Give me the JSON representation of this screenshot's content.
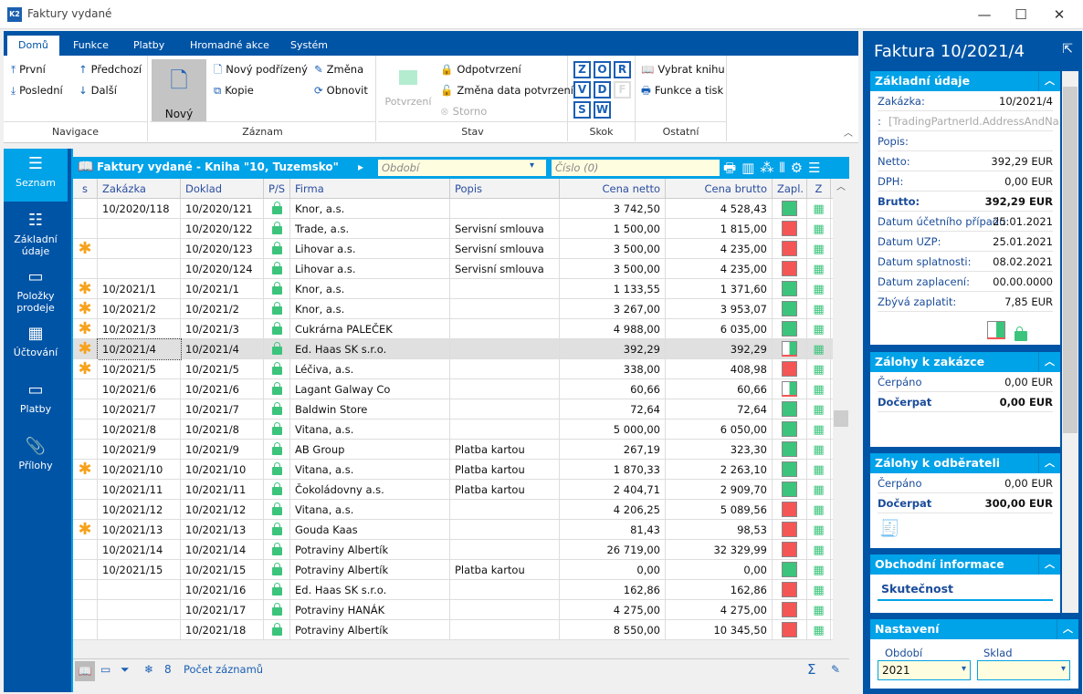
{
  "window": {
    "title": "Faktury vydané",
    "minimize": "—",
    "maximize": "☐",
    "close": "✕"
  },
  "ribbon": {
    "tabs": [
      "Domů",
      "Funkce",
      "Platby",
      "Hromadné akce",
      "Systém"
    ],
    "navigace": {
      "label": "Navigace",
      "prvni": "První",
      "posledni": "Poslední",
      "predchozi": "Předchozí",
      "dalsi": "Další"
    },
    "zaznam": {
      "label": "Záznam",
      "novy": "Nový",
      "novy_podrizeny": "Nový podřízený",
      "kopie": "Kopie",
      "zmena": "Změna",
      "obnovit": "Obnovit"
    },
    "stav": {
      "label": "Stav",
      "potvrzeni": "Potvrzení",
      "odpotvrzeni": "Odpotvrzení",
      "zmena_data": "Změna data potvrzení",
      "storno": "Storno"
    },
    "skok": {
      "label": "Skok",
      "keys": [
        "Z",
        "O",
        "R",
        "V",
        "D",
        "F",
        "S",
        "W"
      ]
    },
    "ostatni": {
      "label": "Ostatní",
      "vybrat_knihu": "Vybrat knihu",
      "funkce_tisk": "Funkce a tisk"
    }
  },
  "sidebar": {
    "items": [
      {
        "label": "Seznam",
        "icon": "list-icon",
        "active": true
      },
      {
        "label": "Základní údaje",
        "icon": "details-icon"
      },
      {
        "label": "Položky prodeje",
        "icon": "box-icon"
      },
      {
        "label": "Účtování",
        "icon": "calculator-icon"
      },
      {
        "label": "Platby",
        "icon": "box-icon"
      },
      {
        "label": "Přílohy",
        "icon": "paperclip-icon"
      }
    ]
  },
  "grid": {
    "title": "Faktury vydané - Kniha \"10, Tuzemsko\"",
    "period_placeholder": "Období",
    "number_placeholder": "Číslo (0)",
    "columns": [
      "s",
      "Zakázka",
      "Doklad",
      "P/S",
      "Firma",
      "Popis",
      "Cena netto",
      "Cena brutto",
      "Zapl.",
      "Z"
    ],
    "rows": [
      {
        "s": "",
        "zakazka": "10/2020/118",
        "doklad": "10/2020/121",
        "firma": "Knor, a.s.",
        "popis": "",
        "netto": "3 742,50",
        "brutto": "4 528,43",
        "zapl": "green"
      },
      {
        "s": "",
        "zakazka": "",
        "doklad": "10/2020/122",
        "firma": "Trade, a.s.",
        "popis": "Servisní smlouva",
        "netto": "1 500,00",
        "brutto": "1 815,00",
        "zapl": "red"
      },
      {
        "s": "*",
        "zakazka": "",
        "doklad": "10/2020/123",
        "firma": "Lihovar a.s.",
        "popis": "Servisní smlouva",
        "netto": "3 500,00",
        "brutto": "4 235,00",
        "zapl": "red"
      },
      {
        "s": "",
        "zakazka": "",
        "doklad": "10/2020/124",
        "firma": "Lihovar a.s.",
        "popis": "Servisní smlouva",
        "netto": "3 500,00",
        "brutto": "4 235,00",
        "zapl": "red"
      },
      {
        "s": "*",
        "zakazka": "10/2021/1",
        "doklad": "10/2021/1",
        "firma": "Knor, a.s.",
        "popis": "",
        "netto": "1 133,55",
        "brutto": "1 371,60",
        "zapl": "green"
      },
      {
        "s": "*",
        "zakazka": "10/2021/2",
        "doklad": "10/2021/2",
        "firma": "Knor, a.s.",
        "popis": "",
        "netto": "3 267,00",
        "brutto": "3 953,07",
        "zapl": "green"
      },
      {
        "s": "*",
        "zakazka": "10/2021/3",
        "doklad": "10/2021/3",
        "firma": "Cukrárna PALEČEK",
        "popis": "",
        "netto": "4 988,00",
        "brutto": "6 035,00",
        "zapl": "green"
      },
      {
        "s": "*",
        "zakazka": "10/2021/4",
        "doklad": "10/2021/4",
        "firma": "Ed. Haas SK s.r.o.",
        "popis": "",
        "netto": "392,29",
        "brutto": "392,29",
        "zapl": "half",
        "selected": true
      },
      {
        "s": "*",
        "zakazka": "10/2021/5",
        "doklad": "10/2021/5",
        "firma": "Léčiva, a.s.",
        "popis": "",
        "netto": "338,00",
        "brutto": "408,98",
        "zapl": "red"
      },
      {
        "s": "",
        "zakazka": "10/2021/6",
        "doklad": "10/2021/6",
        "firma": "Lagant Galway Co",
        "popis": "",
        "netto": "60,66",
        "brutto": "60,66",
        "zapl": "half"
      },
      {
        "s": "",
        "zakazka": "10/2021/7",
        "doklad": "10/2021/7",
        "firma": "Baldwin Store",
        "popis": "",
        "netto": "72,64",
        "brutto": "72,64",
        "zapl": "green"
      },
      {
        "s": "",
        "zakazka": "10/2021/8",
        "doklad": "10/2021/8",
        "firma": "Vitana, a.s.",
        "popis": "",
        "netto": "5 000,00",
        "brutto": "6 050,00",
        "zapl": "green"
      },
      {
        "s": "",
        "zakazka": "10/2021/9",
        "doklad": "10/2021/9",
        "firma": "AB Group",
        "popis": "Platba kartou",
        "netto": "267,19",
        "brutto": "323,30",
        "zapl": "green"
      },
      {
        "s": "*",
        "zakazka": "10/2021/10",
        "doklad": "10/2021/10",
        "firma": "Vitana, a.s.",
        "popis": "Platba kartou",
        "netto": "1 870,33",
        "brutto": "2 263,10",
        "zapl": "green"
      },
      {
        "s": "",
        "zakazka": "10/2021/11",
        "doklad": "10/2021/11",
        "firma": "Čokoládovny a.s.",
        "popis": "Platba kartou",
        "netto": "2 404,71",
        "brutto": "2 909,70",
        "zapl": "green"
      },
      {
        "s": "",
        "zakazka": "10/2021/12",
        "doklad": "10/2021/12",
        "firma": "Vitana, a.s.",
        "popis": "",
        "netto": "4 206,25",
        "brutto": "5 089,56",
        "zapl": "red"
      },
      {
        "s": "*",
        "zakazka": "10/2021/13",
        "doklad": "10/2021/13",
        "firma": "Gouda Kaas",
        "popis": "",
        "netto": "81,43",
        "brutto": "98,53",
        "zapl": "red"
      },
      {
        "s": "",
        "zakazka": "10/2021/14",
        "doklad": "10/2021/14",
        "firma": "Potraviny Albertík",
        "popis": "",
        "netto": "26 719,00",
        "brutto": "32 329,99",
        "zapl": "red"
      },
      {
        "s": "",
        "zakazka": "10/2021/15",
        "doklad": "10/2021/15",
        "firma": "Potraviny Albertík",
        "popis": "Platba kartou",
        "netto": "0,00",
        "brutto": "0,00",
        "zapl": "green"
      },
      {
        "s": "",
        "zakazka": "",
        "doklad": "10/2021/16",
        "firma": "Ed. Haas SK s.r.o.",
        "popis": "",
        "netto": "162,86",
        "brutto": "162,86",
        "zapl": "red"
      },
      {
        "s": "",
        "zakazka": "",
        "doklad": "10/2021/17",
        "firma": "Potraviny HANÁK",
        "popis": "",
        "netto": "4 275,00",
        "brutto": "4 275,00",
        "zapl": "red"
      },
      {
        "s": "",
        "zakazka": "",
        "doklad": "10/2021/18",
        "firma": "Potraviny Albertík",
        "popis": "",
        "netto": "8 550,00",
        "brutto": "10 345,50",
        "zapl": "red"
      }
    ],
    "footer": {
      "count": "8",
      "count_label": "Počet záznamů",
      "sum": "Σ"
    }
  },
  "detail": {
    "title": "Faktura 10/2021/4",
    "zakladni": {
      "title": "Základní údaje",
      "rows": [
        {
          "k": "Zakázka:",
          "v": "10/2021/4"
        },
        {
          "k": ":",
          "v": "[TradingPartnerId.AddressAndNa..."
        },
        {
          "k": "Popis:",
          "v": ""
        },
        {
          "k": "Netto:",
          "v": "392,29 EUR"
        },
        {
          "k": "DPH:",
          "v": "0,00 EUR"
        },
        {
          "k": "Brutto:",
          "v": "392,29 EUR",
          "bold": true
        },
        {
          "k": "Datum účetního případu:",
          "v": "25.01.2021"
        },
        {
          "k": "Datum UZP:",
          "v": "25.01.2021"
        },
        {
          "k": "Datum splatnosti:",
          "v": "08.02.2021"
        },
        {
          "k": "Datum zaplacení:",
          "v": "00.00.0000"
        },
        {
          "k": "Zbývá zaplatit:",
          "v": "7,85 EUR"
        }
      ]
    },
    "zalohy_zakazce": {
      "title": "Zálohy k zakázce",
      "cerpano_label": "Čerpáno",
      "cerpano": "0,00 EUR",
      "docerpat_label": "Dočerpat",
      "docerpat": "0,00 EUR"
    },
    "zalohy_odberateli": {
      "title": "Zálohy k odběrateli",
      "cerpano_label": "Čerpáno",
      "cerpano": "0,00 EUR",
      "docerpat_label": "Dočerpat",
      "docerpat": "300,00 EUR"
    },
    "obchodni": {
      "title": "Obchodní informace",
      "tab": "Skutečnost"
    },
    "nastaveni": {
      "title": "Nastavení",
      "obdobi_label": "Období",
      "obdobi": "2021",
      "sklad_label": "Sklad",
      "sklad": ""
    }
  },
  "colors": {
    "brand": "#0054a6",
    "accent": "#00a2e8",
    "paid": "#3cc47c",
    "unpaid": "#f45555",
    "star": "#f7a21b"
  }
}
